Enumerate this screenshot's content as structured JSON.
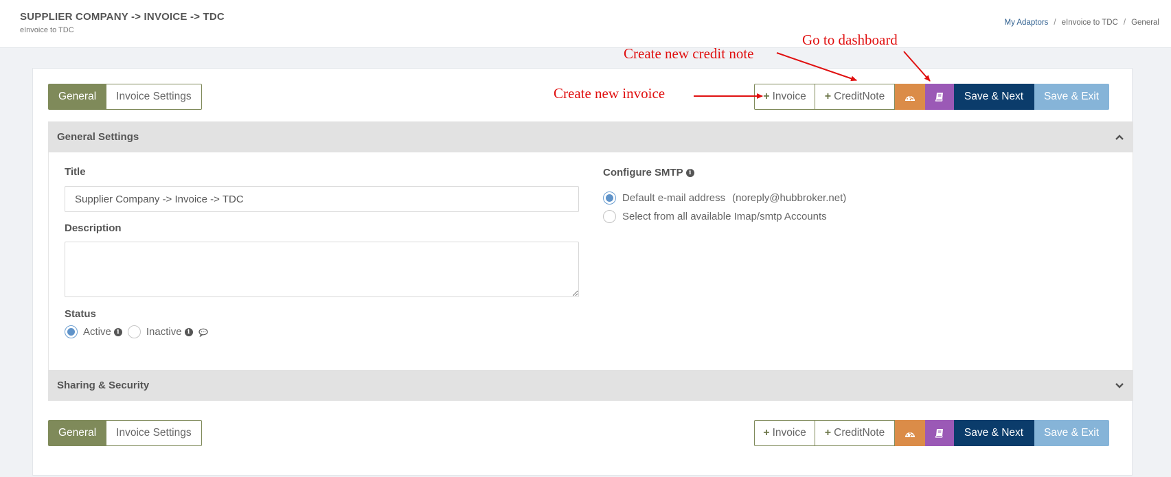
{
  "header": {
    "title": "SUPPLIER COMPANY -> INVOICE -> TDC",
    "subtitle": "eInvoice to TDC",
    "breadcrumb": [
      "My Adaptors",
      "eInvoice to TDC",
      "General"
    ]
  },
  "tabs": [
    "General",
    "Invoice Settings"
  ],
  "toolbar": {
    "invoice_label": "Invoice",
    "creditnote_label": "CreditNote",
    "dashboard_icon": "dashboard-icon",
    "book_icon": "book-icon",
    "save_next_label": "Save & Next",
    "save_exit_label": "Save & Exit"
  },
  "general_settings": {
    "heading": "General Settings",
    "title_label": "Title",
    "title_value": "Supplier Company -> Invoice -> TDC",
    "description_label": "Description",
    "description_value": "",
    "status_label": "Status",
    "status_options": [
      "Active",
      "Inactive"
    ],
    "status_selected": "Active",
    "smtp_label": "Configure SMTP",
    "smtp_options": [
      "Default e-mail address",
      "Select from all available Imap/smtp Accounts"
    ],
    "smtp_default_email": "(noreply@hubbroker.net)"
  },
  "sharing_security": {
    "heading": "Sharing & Security"
  },
  "annotations": {
    "invoice": "Create new invoice",
    "creditnote": "Create new credit note",
    "dashboard": "Go to dashboard"
  },
  "colors": {
    "tab_active": "#7f8a5a",
    "dashboard_btn": "#db8c48",
    "book_btn": "#9b59b6",
    "save_next_btn": "#0b3c6b",
    "save_exit_btn": "#86b4d8",
    "annotation": "#e01010"
  }
}
